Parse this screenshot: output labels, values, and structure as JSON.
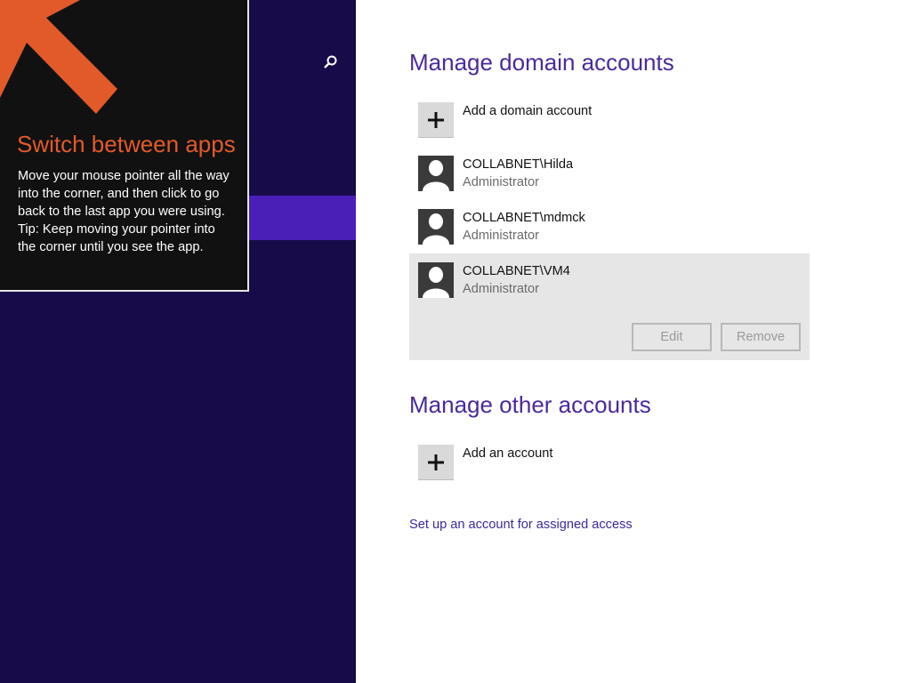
{
  "tip": {
    "title": "Switch between apps",
    "body_lines": [
      "Move your mouse pointer all the way into the corner, and then click to go back to the last app you were using.",
      "Tip: Keep moving your pointer into the corner until you see the app."
    ]
  },
  "domain_section": {
    "title": "Manage domain accounts",
    "add_label": "Add a domain account",
    "accounts": [
      {
        "name": "COLLABNET\\Hilda",
        "role": "Administrator"
      },
      {
        "name": "COLLABNET\\mdmck",
        "role": "Administrator"
      },
      {
        "name": "COLLABNET\\VM4",
        "role": "Administrator"
      }
    ],
    "edit_label": "Edit",
    "remove_label": "Remove"
  },
  "other_section": {
    "title": "Manage other accounts",
    "add_label": "Add an account"
  },
  "assigned_access_link": "Set up an account for assigned access",
  "colors": {
    "left_background": "#180b4a",
    "selected_strip": "#4a1fb8",
    "tip_title": "#e25a2a",
    "heading": "#4a2a9a"
  },
  "icons": {
    "search": "search-icon",
    "add": "plus-icon",
    "user": "user-avatar-icon",
    "corner_arrow": "arrow-up-left-icon"
  }
}
